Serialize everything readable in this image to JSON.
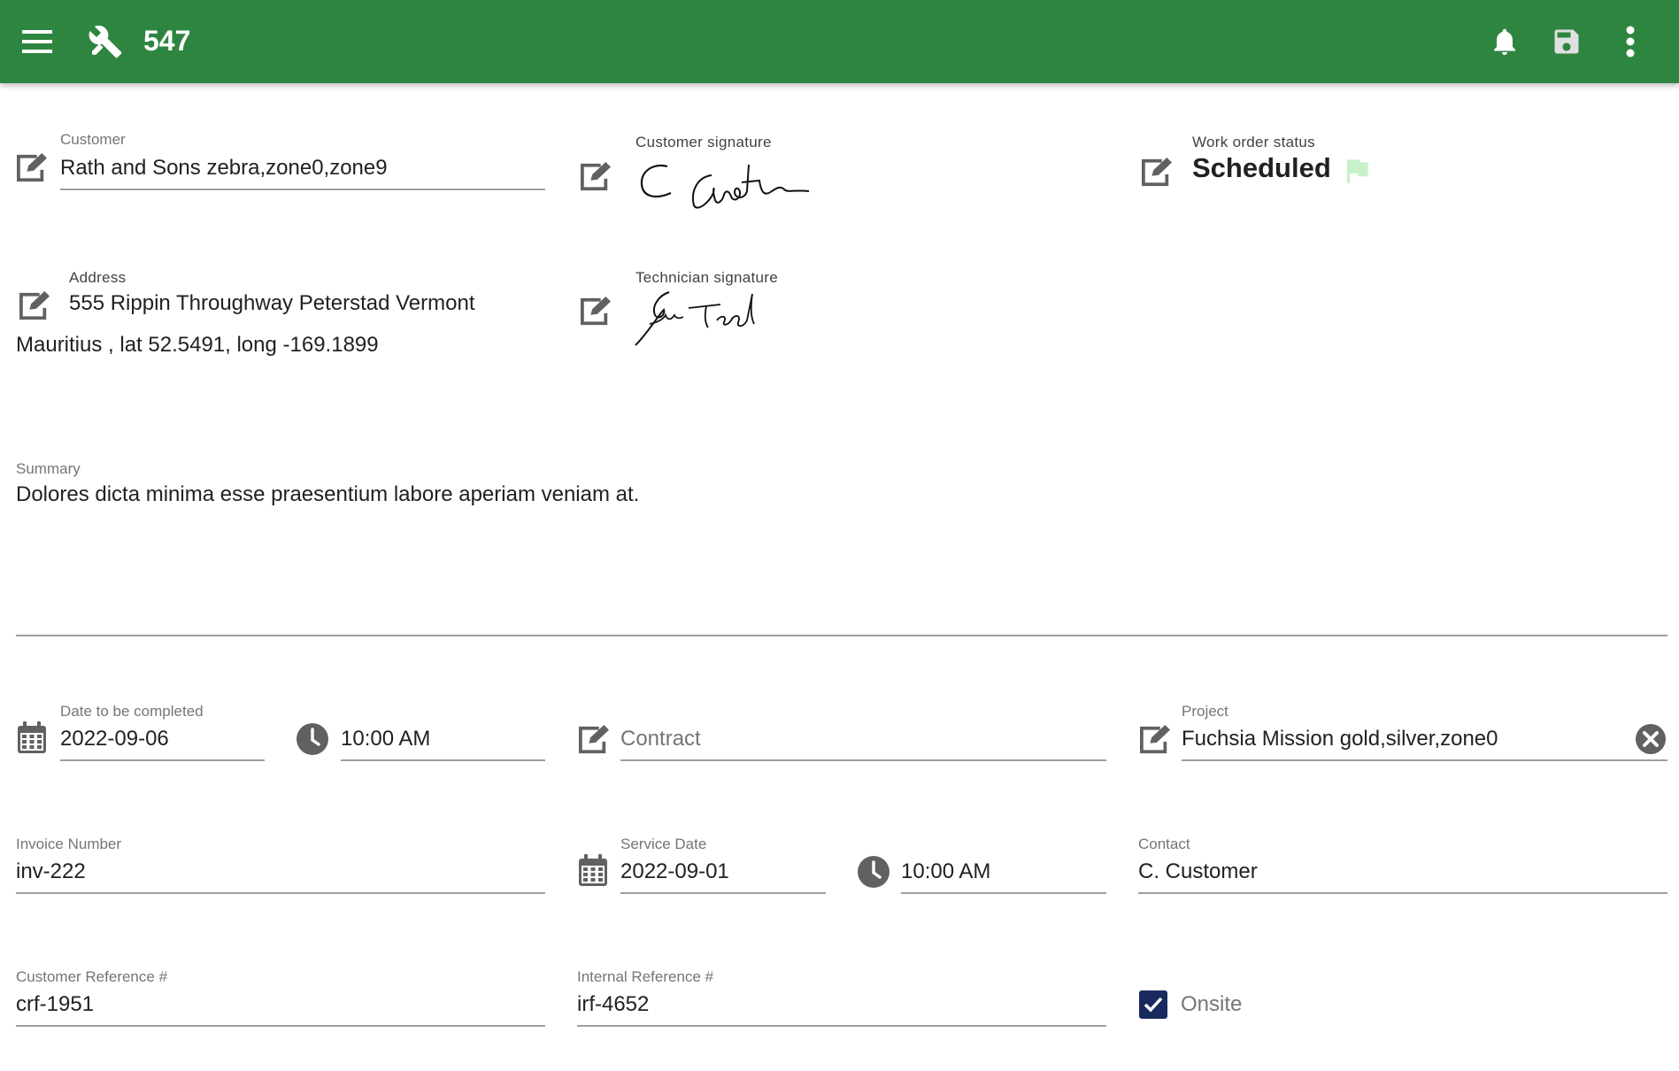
{
  "header": {
    "title": "547",
    "icons": [
      "menu-icon",
      "tools-icon",
      "bell-icon",
      "save-icon",
      "more-vert-icon"
    ]
  },
  "customer": {
    "label": "Customer",
    "value": "Rath and Sons zebra,zone0,zone9"
  },
  "customer_signature": {
    "label": "Customer signature"
  },
  "work_order_status": {
    "label": "Work order status",
    "value": "Scheduled",
    "flag_color": "#c8f0c8"
  },
  "address": {
    "label": "Address",
    "line1": "555 Rippin Throughway Peterstad Vermont",
    "line2": "Mauritius , lat 52.5491, long -169.1899"
  },
  "technician_signature": {
    "label": "Technician signature"
  },
  "summary": {
    "label": "Summary",
    "value": "Dolores dicta minima esse praesentium labore aperiam veniam at."
  },
  "date_to_complete": {
    "label": "Date to be completed",
    "date": "2022-09-06",
    "time": "10:00 AM"
  },
  "contract": {
    "placeholder": "Contract"
  },
  "project": {
    "label": "Project",
    "value": "Fuchsia Mission gold,silver,zone0"
  },
  "invoice": {
    "label": "Invoice Number",
    "value": "inv-222"
  },
  "service_date": {
    "label": "Service Date",
    "date": "2022-09-01",
    "time": "10:00 AM"
  },
  "contact": {
    "label": "Contact",
    "value": "C. Customer"
  },
  "customer_ref": {
    "label": "Customer Reference #",
    "value": "crf-1951"
  },
  "internal_ref": {
    "label": "Internal Reference #",
    "value": "irf-4652"
  },
  "onsite": {
    "label": "Onsite",
    "checked": true
  },
  "colors": {
    "appbar": "#2e8540",
    "icon_grey": "#616161",
    "checkbox": "#1a2a5e"
  }
}
